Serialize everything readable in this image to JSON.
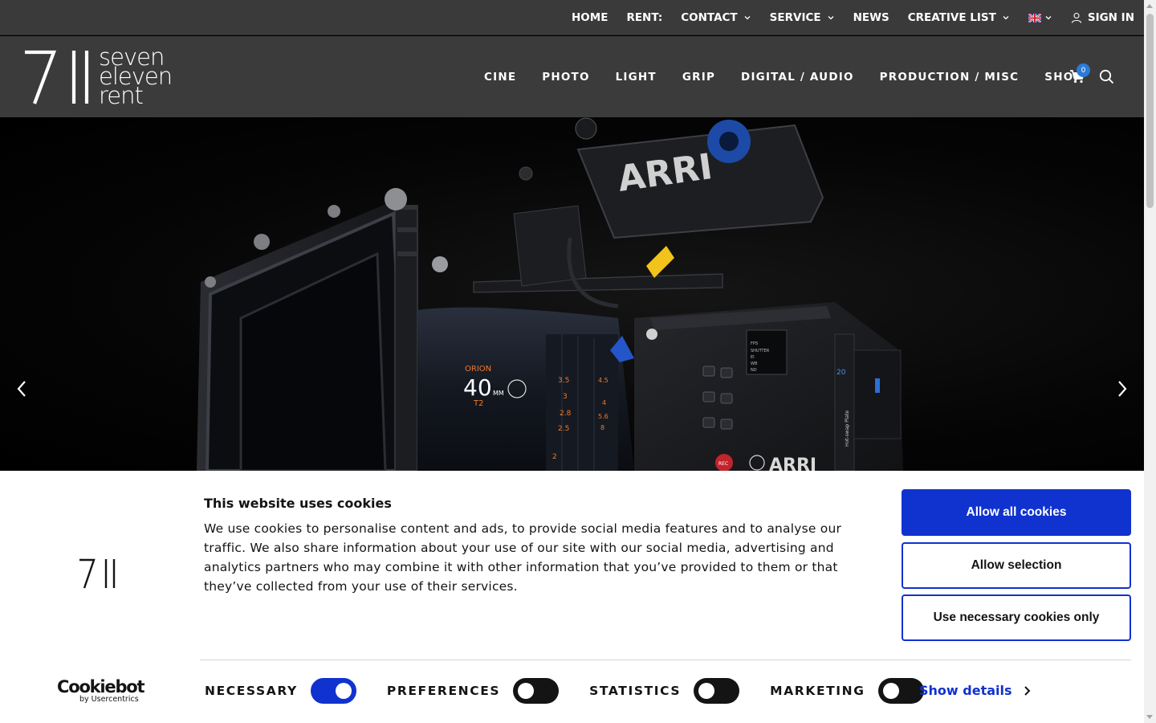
{
  "topnav": {
    "items": [
      {
        "label": "HOME",
        "chevron": false
      },
      {
        "label": "RENT:",
        "chevron": false
      },
      {
        "label": "CONTACT",
        "chevron": true
      },
      {
        "label": "SERVICE",
        "chevron": true
      },
      {
        "label": "NEWS",
        "chevron": false
      },
      {
        "label": "CREATIVE LIST",
        "chevron": true
      }
    ],
    "language_icon": "uk-flag-icon",
    "sign_in": "SIGN IN"
  },
  "brand": {
    "mark": "7||",
    "words": [
      "seven",
      "eleven",
      "rent"
    ]
  },
  "mainnav": {
    "items": [
      "CINE",
      "PHOTO",
      "LIGHT",
      "GRIP",
      "DIGITAL / AUDIO",
      "PRODUCTION / MISC",
      "SHOP"
    ],
    "cart_count": "0"
  },
  "hero": {
    "camera_brand": "ARRI",
    "lens_brand": "ORION",
    "lens_focal": "40",
    "lens_unit": "MM",
    "lens_stop": "T2",
    "rec_label": "REC",
    "focus_scale": [
      "3.5",
      "3",
      "2.8",
      "2.5",
      "2"
    ],
    "aperture_scale": [
      "4.5",
      "4",
      "5.6",
      "8"
    ],
    "screen_lines": [
      "FPS",
      "SHUTTER",
      "EI",
      "WB",
      "ND"
    ],
    "side_plate": "Hot-swap Plate",
    "side_code": "20",
    "brand_mark": "7||"
  },
  "cookie": {
    "title": "This website uses cookies",
    "body": "We use cookies to personalise content and ads, to provide social media features and to analyse our traffic. We also share information about your use of our site with our social media, advertising and analytics partners who may combine it with other information that you’ve provided to them or that they’ve collected from your use of their services.",
    "buttons": {
      "allow_all": "Allow all cookies",
      "allow_selection": "Allow selection",
      "necessary_only": "Use necessary cookies only"
    },
    "toggles": [
      {
        "label": "NECESSARY",
        "on": true
      },
      {
        "label": "PREFERENCES",
        "on": false
      },
      {
        "label": "STATISTICS",
        "on": false
      },
      {
        "label": "MARKETING",
        "on": false
      }
    ],
    "show_details": "Show details",
    "provider": {
      "name": "Cookiebot",
      "sub": "by Usercentrics"
    }
  },
  "colors": {
    "accent": "#1032cf",
    "topbar": "#3a3a3a",
    "mainbar": "#3b3b3b",
    "badge": "#2b7bd6",
    "lens_orange": "#f07a2a"
  }
}
